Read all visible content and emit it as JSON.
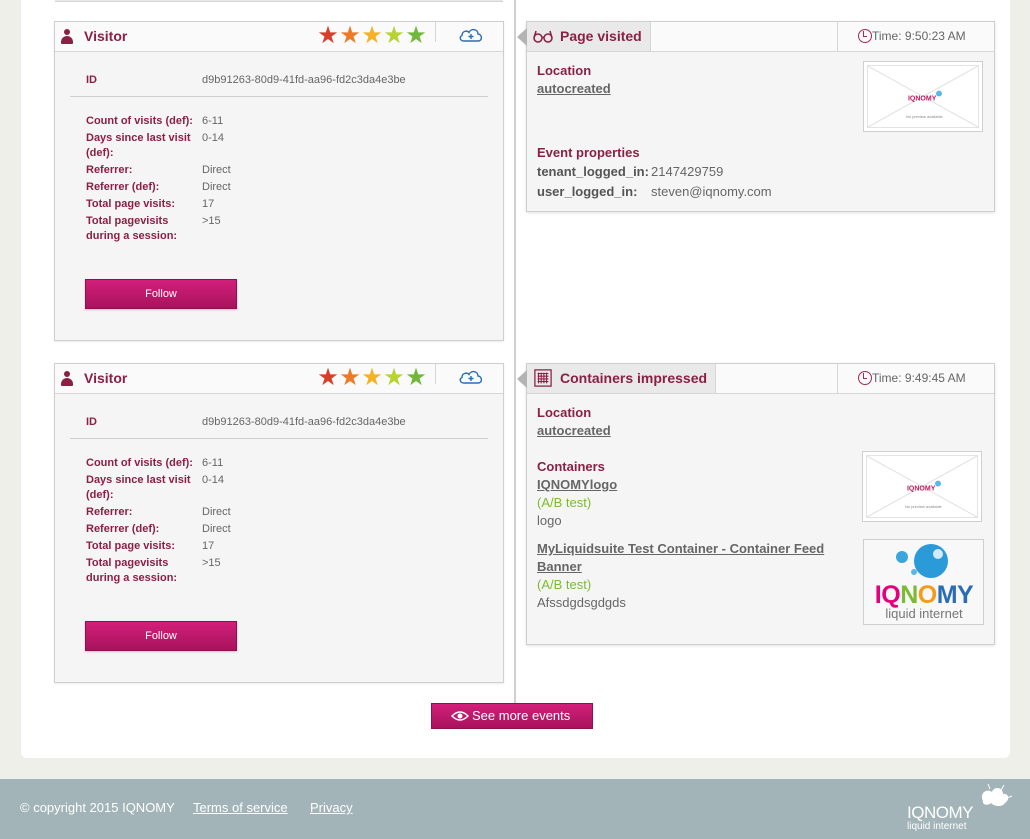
{
  "visitors": [
    {
      "title": "Visitor",
      "id_label": "ID",
      "id_value": "d9b91263-80d9-41fd-aa96-fd2c3da4e3be",
      "props": [
        {
          "label": "Count of visits (def):",
          "value": "6-11"
        },
        {
          "label": "Days since last visit (def):",
          "value": "0-14"
        },
        {
          "label": "Referrer:",
          "value": "Direct"
        },
        {
          "label": "Referrer (def):",
          "value": "Direct"
        },
        {
          "label": "Total page visits:",
          "value": "17"
        },
        {
          "label": "Total pagevisits during a session:",
          "value": ">15"
        }
      ],
      "follow_label": "Follow",
      "rating": 5
    },
    {
      "title": "Visitor",
      "id_label": "ID",
      "id_value": "d9b91263-80d9-41fd-aa96-fd2c3da4e3be",
      "props": [
        {
          "label": "Count of visits (def):",
          "value": "6-11"
        },
        {
          "label": "Days since last visit (def):",
          "value": "0-14"
        },
        {
          "label": "Referrer:",
          "value": "Direct"
        },
        {
          "label": "Referrer (def):",
          "value": "Direct"
        },
        {
          "label": "Total page visits:",
          "value": "17"
        },
        {
          "label": "Total pagevisits during a session:",
          "value": ">15"
        }
      ],
      "follow_label": "Follow",
      "rating": 5
    }
  ],
  "star_colors": [
    "#d6402b",
    "#ec7a27",
    "#f3b227",
    "#b9d334",
    "#6fb83a"
  ],
  "events": [
    {
      "type_icon": "glasses-icon",
      "title": "Page visited",
      "time": "Time: 9:50:23 AM",
      "location_label": "Location",
      "location_value": "autocreated",
      "props_label": "Event properties",
      "props": [
        {
          "key": "tenant_logged_in:",
          "value": "2147429759"
        },
        {
          "key": "user_logged_in:",
          "value": "steven@iqnomy.com"
        }
      ],
      "thumb_caption": "No preview available"
    },
    {
      "type_icon": "grid-icon",
      "title": "Containers impressed",
      "time": "Time: 9:49:45 AM",
      "location_label": "Location",
      "location_value": "autocreated",
      "containers_label": "Containers",
      "containers": [
        {
          "name": "IQNOMYlogo",
          "tag": "(A/B test)",
          "variant": "logo",
          "thumb_caption": "No preview available"
        },
        {
          "name": "MyLiquidsuite Test Container - Container Feed Banner",
          "tag": "(A/B test)",
          "variant": "Afssdgdsgdgds",
          "logo_text": "IQNOMY",
          "logo_sub": "liquid internet"
        }
      ]
    }
  ],
  "see_more_label": "See more events",
  "footer": {
    "copyright": "© copyright 2015 IQNOMY",
    "terms": "Terms of service",
    "privacy": "Privacy",
    "logo_text": "IQNOMY",
    "logo_sub": "liquid internet"
  },
  "colors": {
    "accent": "#8a2145",
    "button": "#c0186c",
    "ab_green": "#7bbb33",
    "footer_bg": "#a2b4b8"
  }
}
